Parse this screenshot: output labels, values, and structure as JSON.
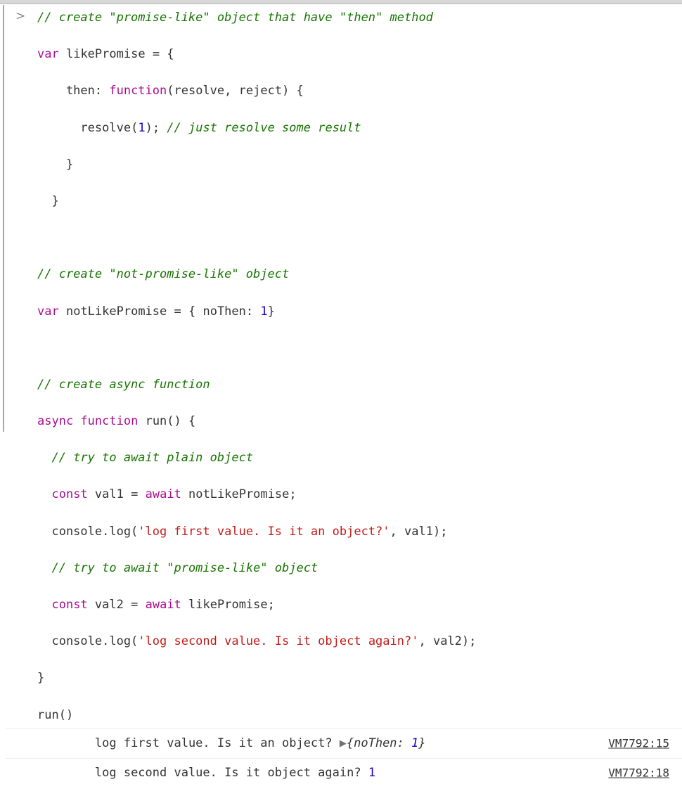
{
  "window": {
    "app": "Chrome DevTools Console",
    "top_strip_color": "#d8d8d8"
  },
  "colors": {
    "comment": "#177500",
    "keyword": "#aa0d91",
    "identifier": "#3b3bb5",
    "operator": "#b35000",
    "string": "#c41a16",
    "number": "#1c00cf",
    "plain": "#333333",
    "divider": "#ececec",
    "link": "#333333"
  },
  "input": {
    "prompt_symbol": ">",
    "lines": [
      [
        {
          "t": "// create \"promise-like\" object that have \"then\" method",
          "c": "comment"
        }
      ],
      [
        {
          "t": "var",
          "c": "keyword"
        },
        {
          "t": " ",
          "c": "plain"
        },
        {
          "t": "likePromise",
          "c": "identifier"
        },
        {
          "t": " ",
          "c": "plain"
        },
        {
          "t": "=",
          "c": "operator"
        },
        {
          "t": " {",
          "c": "plain"
        }
      ],
      [
        {
          "t": "    then: ",
          "c": "plain"
        },
        {
          "t": "function",
          "c": "keyword"
        },
        {
          "t": "(",
          "c": "plain"
        },
        {
          "t": "resolve",
          "c": "identifier"
        },
        {
          "t": ", ",
          "c": "plain"
        },
        {
          "t": "reject",
          "c": "identifier"
        },
        {
          "t": ") {",
          "c": "plain"
        }
      ],
      [
        {
          "t": "      ",
          "c": "plain"
        },
        {
          "t": "resolve",
          "c": "identifier"
        },
        {
          "t": "(",
          "c": "plain"
        },
        {
          "t": "1",
          "c": "number"
        },
        {
          "t": "); ",
          "c": "plain"
        },
        {
          "t": "// just resolve some result",
          "c": "comment"
        }
      ],
      [
        {
          "t": "    }",
          "c": "plain"
        }
      ],
      [
        {
          "t": "  }",
          "c": "plain"
        }
      ],
      [
        {
          "t": " ",
          "c": "plain"
        }
      ],
      [
        {
          "t": "// create \"not-promise-like\" object",
          "c": "comment"
        }
      ],
      [
        {
          "t": "var",
          "c": "keyword"
        },
        {
          "t": " ",
          "c": "plain"
        },
        {
          "t": "notLikePromise",
          "c": "identifier"
        },
        {
          "t": " ",
          "c": "plain"
        },
        {
          "t": "=",
          "c": "operator"
        },
        {
          "t": " { noThen: ",
          "c": "plain"
        },
        {
          "t": "1",
          "c": "number"
        },
        {
          "t": "}",
          "c": "plain"
        }
      ],
      [
        {
          "t": " ",
          "c": "plain"
        }
      ],
      [
        {
          "t": "// create async function",
          "c": "comment"
        }
      ],
      [
        {
          "t": "async",
          "c": "keyword"
        },
        {
          "t": " ",
          "c": "plain"
        },
        {
          "t": "function",
          "c": "keyword"
        },
        {
          "t": " ",
          "c": "plain"
        },
        {
          "t": "run",
          "c": "identifier"
        },
        {
          "t": "() {",
          "c": "plain"
        }
      ],
      [
        {
          "t": "  ",
          "c": "plain"
        },
        {
          "t": "// try to await plain object",
          "c": "comment"
        }
      ],
      [
        {
          "t": "  ",
          "c": "plain"
        },
        {
          "t": "const",
          "c": "keyword"
        },
        {
          "t": " ",
          "c": "plain"
        },
        {
          "t": "val1",
          "c": "identifier"
        },
        {
          "t": " ",
          "c": "plain"
        },
        {
          "t": "=",
          "c": "operator"
        },
        {
          "t": " ",
          "c": "plain"
        },
        {
          "t": "await",
          "c": "keyword"
        },
        {
          "t": " notLikePromise;",
          "c": "plain"
        }
      ],
      [
        {
          "t": "  console.log(",
          "c": "plain"
        },
        {
          "t": "'log first value. Is it an object?'",
          "c": "string"
        },
        {
          "t": ", ",
          "c": "plain"
        },
        {
          "t": "val1",
          "c": "identifier"
        },
        {
          "t": ");",
          "c": "plain"
        }
      ],
      [
        {
          "t": "  ",
          "c": "plain"
        },
        {
          "t": "// try to await \"promise-like\" object",
          "c": "comment"
        }
      ],
      [
        {
          "t": "  ",
          "c": "plain"
        },
        {
          "t": "const",
          "c": "keyword"
        },
        {
          "t": " ",
          "c": "plain"
        },
        {
          "t": "val2",
          "c": "identifier"
        },
        {
          "t": " ",
          "c": "plain"
        },
        {
          "t": "=",
          "c": "operator"
        },
        {
          "t": " ",
          "c": "plain"
        },
        {
          "t": "await",
          "c": "keyword"
        },
        {
          "t": " likePromise;",
          "c": "plain"
        }
      ],
      [
        {
          "t": "  console.log(",
          "c": "plain"
        },
        {
          "t": "'log second value. Is it object again?'",
          "c": "string"
        },
        {
          "t": ", ",
          "c": "plain"
        },
        {
          "t": "val2",
          "c": "identifier"
        },
        {
          "t": ");",
          "c": "plain"
        }
      ],
      [
        {
          "t": "}",
          "c": "plain"
        }
      ],
      [
        {
          "t": "run()",
          "c": "plain"
        }
      ]
    ]
  },
  "output": {
    "rows": [
      {
        "message": "log first value. Is it an object? ",
        "toggle": "▶",
        "preview": "{noThen: ",
        "preview_number": "1",
        "preview_tail": "}",
        "value": null,
        "source": "VM7792:15"
      },
      {
        "message": "log second value. Is it object again? ",
        "toggle": null,
        "preview": null,
        "preview_number": null,
        "preview_tail": null,
        "value": "1",
        "source": "VM7792:18"
      }
    ]
  }
}
